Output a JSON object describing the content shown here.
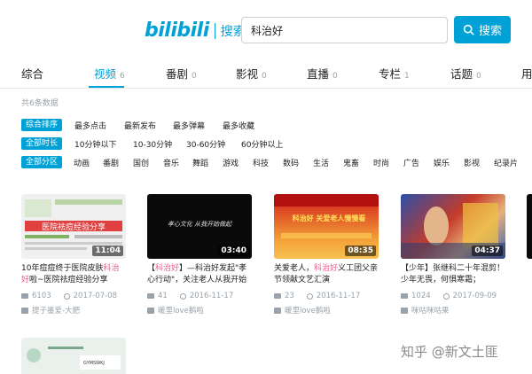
{
  "header": {
    "logo_mark": "bilibili",
    "logo_text": "搜索",
    "search_value": "科治好",
    "search_button": "搜索"
  },
  "tabs": [
    {
      "label": "综合",
      "count": ""
    },
    {
      "label": "视频",
      "count": "6"
    },
    {
      "label": "番剧",
      "count": "0"
    },
    {
      "label": "影视",
      "count": "0"
    },
    {
      "label": "直播",
      "count": "0"
    },
    {
      "label": "专栏",
      "count": "1"
    },
    {
      "label": "话题",
      "count": "0"
    },
    {
      "label": "用",
      "count": ""
    }
  ],
  "total_text": "共6条数据",
  "filters": {
    "sort": {
      "label": "综合排序",
      "items": [
        "最多点击",
        "最新发布",
        "最多弹幕",
        "最多收藏"
      ]
    },
    "duration": {
      "label": "全部时长",
      "items": [
        "10分钟以下",
        "10-30分钟",
        "30-60分钟",
        "60分钟以上"
      ]
    },
    "zone": {
      "label": "全部分区",
      "items": [
        "动画",
        "番剧",
        "国创",
        "音乐",
        "舞蹈",
        "游戏",
        "科技",
        "数码",
        "生活",
        "鬼畜",
        "时尚",
        "广告",
        "娱乐",
        "影视",
        "纪录片"
      ]
    }
  },
  "videos": [
    {
      "duration": "11:04",
      "title_pre": "10年痘痘终于医院皮肤",
      "title_hl": "科治好",
      "title_post": "啦~医院祛痘经验分享",
      "plays": "6103",
      "date": "2017-07-08",
      "uploader": "提子墨爱-大肥",
      "thumb_text": "医院祛痘经验分享"
    },
    {
      "duration": "03:40",
      "title_pre": "【",
      "title_hl": "科治好",
      "title_post": "】—科治好发起\"孝心行动\"，关注老人从我开始",
      "plays": "41",
      "date": "2016-11-17",
      "uploader": "暖里love鹅啦",
      "thumb_text": "孝心文化 从我开始做起"
    },
    {
      "duration": "08:35",
      "title_pre": "关爱老人，",
      "title_hl": "科治好",
      "title_post": "义工团父亲节领献文艺汇演",
      "plays": "23",
      "date": "2016-11-17",
      "uploader": "暖里love鹅啦",
      "thumb_text": "科治好 关爱老人慢慢看"
    },
    {
      "duration": "04:37",
      "title_pre": "【少年】张继科二十年混剪！少年无畏，何惧寒霜；",
      "title_hl": "",
      "title_post": "",
      "plays": "1024",
      "date": "2017-09-09",
      "uploader": "咪咕咪咕果",
      "thumb_text": ""
    }
  ],
  "partial_card": {
    "thumb_text": "GYMSWKJ"
  },
  "watermark": "知乎 @新文土匪"
}
